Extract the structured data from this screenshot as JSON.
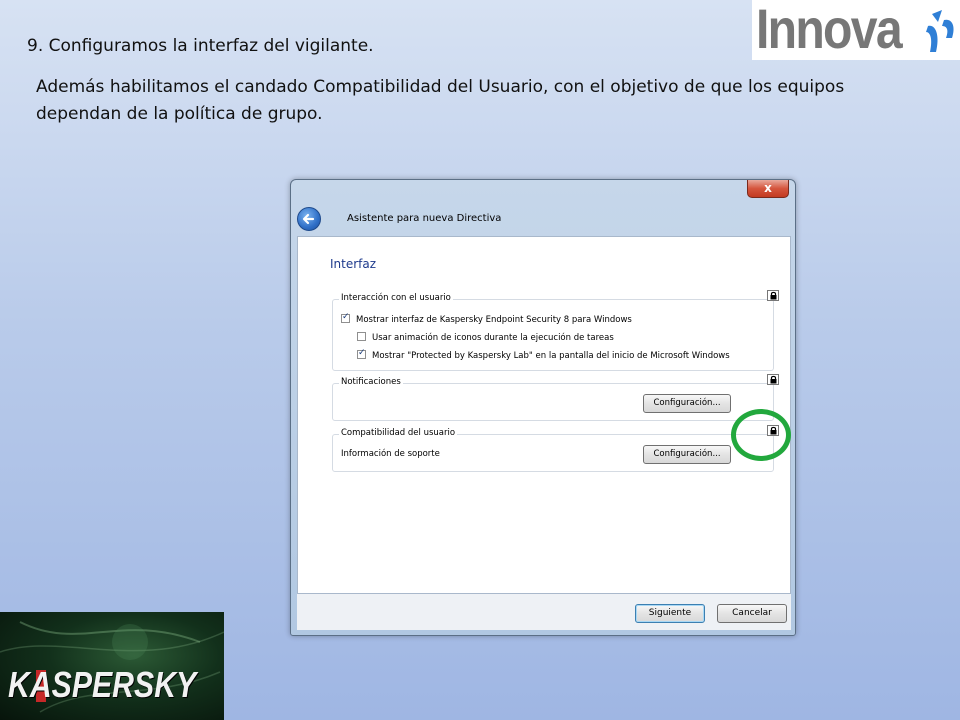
{
  "slide": {
    "title": "9. Configuramos la interfaz del vigilante.",
    "description": "Además habilitamos el candado Compatibilidad del Usuario, con el objetivo de que los equipos dependan de la política de grupo."
  },
  "logos": {
    "innova": "Innova",
    "kaspersky": "KASPERSKY"
  },
  "window": {
    "close_label": "x",
    "wizard_title": "Asistente para nueva Directiva",
    "page_heading": "Interfaz",
    "groups": {
      "interaction": {
        "title": "Interacción con el usuario",
        "show_interface": "Mostrar interfaz de Kaspersky Endpoint Security 8 para Windows",
        "use_animation": "Usar animación de iconos durante la ejecución de tareas",
        "show_protected": "Mostrar \"Protected by Kaspersky Lab\" en la pantalla del inicio de Microsoft Windows"
      },
      "notifications": {
        "title": "Notificaciones",
        "button": "Configuración..."
      },
      "compatibility": {
        "title": "Compatibilidad del usuario",
        "label": "Información de soporte",
        "button": "Configuración..."
      }
    },
    "footer": {
      "next": "Siguiente",
      "cancel": "Cancelar"
    }
  },
  "checkboxes": {
    "show_interface": true,
    "use_animation": false,
    "show_protected": true
  },
  "colors": {
    "highlight_circle": "#22a83d",
    "heading_blue": "#1e3a8c"
  },
  "icons": [
    "back-arrow-icon",
    "close-icon",
    "lock-icon"
  ]
}
